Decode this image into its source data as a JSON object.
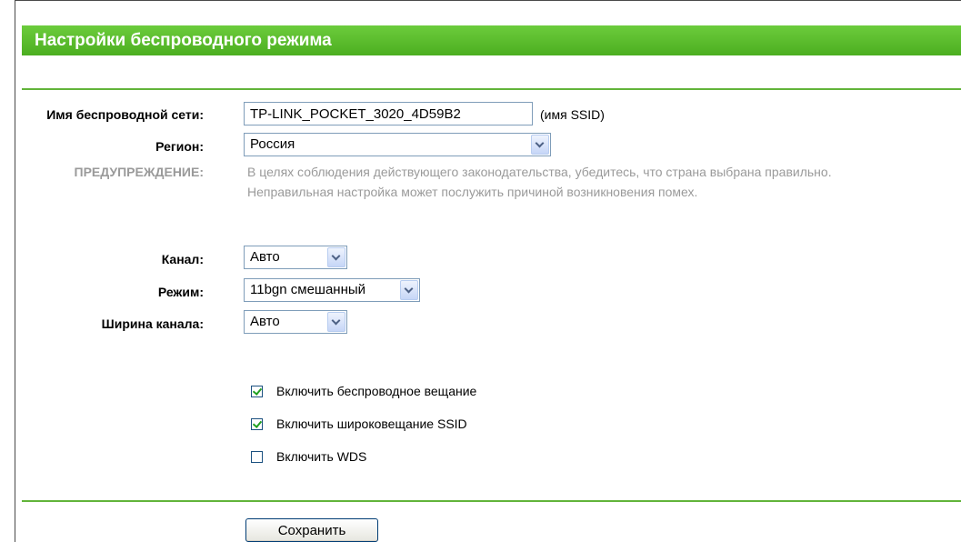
{
  "page": {
    "title": "Настройки беспроводного режима"
  },
  "ssid": {
    "label": "Имя беспроводной сети:",
    "value": "TP-LINK_POCKET_3020_4D59B2",
    "hint": "(имя SSID)"
  },
  "region": {
    "label": "Регион:",
    "value": "Россия"
  },
  "warning": {
    "label": "ПРЕДУПРЕЖДЕНИЕ:",
    "line1": "В целях соблюдения действующего законодательства, убедитесь, что страна выбрана правильно.",
    "line2": "Неправильная настройка может послужить причиной возникновения помех."
  },
  "channel": {
    "label": "Канал:",
    "value": "Авто"
  },
  "mode": {
    "label": "Режим:",
    "value": "11bgn смешанный"
  },
  "channel_width": {
    "label": "Ширина канала:",
    "value": "Авто"
  },
  "checkboxes": [
    {
      "label": "Включить беспроводное вещание",
      "checked": true
    },
    {
      "label": "Включить широковещание SSID",
      "checked": true
    },
    {
      "label": "Включить WDS",
      "checked": false
    }
  ],
  "save_button": {
    "label": "Сохранить"
  },
  "colors": {
    "header_green": "#5bbd2b",
    "rule_green": "#62b43a",
    "warning_gray": "#9a9a9a",
    "check_green": "#21a121"
  }
}
